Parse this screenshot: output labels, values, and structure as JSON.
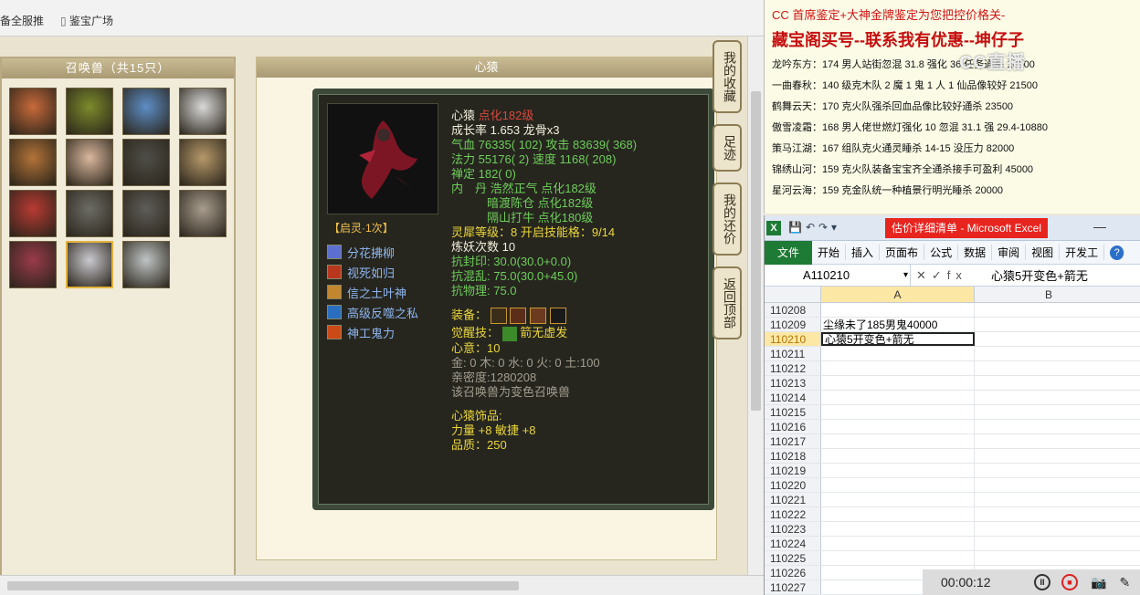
{
  "browser": {
    "bookmarks": [
      {
        "label": "备全服推"
      },
      {
        "label": "鉴宝广场"
      }
    ]
  },
  "summons_panel": {
    "title": "召唤兽（共15只）",
    "pets": [
      {
        "color": "#c86a3a"
      },
      {
        "color": "#7c8b2b"
      },
      {
        "color": "#5d8ec6"
      },
      {
        "color": "#d9d9d9"
      },
      {
        "color": "#b37338"
      },
      {
        "color": "#d9b79d"
      },
      {
        "color": "#4e4e48"
      },
      {
        "color": "#b6996a"
      },
      {
        "color": "#b83a33"
      },
      {
        "color": "#6c6c66"
      },
      {
        "color": "#5e5d59"
      },
      {
        "color": "#a89d8e"
      },
      {
        "color": "#9a3b4a"
      },
      {
        "color": "#c9c9cf",
        "selected": true
      },
      {
        "color": "#bfc4c4"
      }
    ]
  },
  "detail_panel": {
    "title": "心猿",
    "awaken": "启灵·1次",
    "skills": [
      {
        "label": "分花拂柳",
        "color": "#5c6fd0"
      },
      {
        "label": "视死如归",
        "color": "#b9371c"
      },
      {
        "label": "信之土叶神",
        "color": "#c2862e"
      },
      {
        "label": "高级反噬之私",
        "color": "#2a6fbf"
      },
      {
        "label": "神工鬼力",
        "color": "#cc4a17"
      }
    ],
    "stats": {
      "name": "心猿",
      "level": "点化182级",
      "growth": "成长率 1.653 龙骨x3",
      "hp": "气血 76335( 102) 攻击 83639( 368)",
      "mp": "法力 55176( 2) 速度 1168( 208)",
      "ding": "禅定 182( 0)",
      "neidan": [
        "内　丹 浩然正气 点化182级",
        "　　　暗渡陈仓 点化182级",
        "　　　隔山打牛 点化180级"
      ],
      "lingxi": "灵犀等级：8 开启技能格：9/14",
      "lianyao": "炼妖次数 10",
      "kangfeng": "抗封印: 30.0(30.0+0.0)",
      "kanghun": "抗混乱: 75.0(30.0+45.0)",
      "kangwuli": "抗物理: 75.0",
      "equip_label": "装备：",
      "awaken_skill_label": "觉醒技：",
      "awaken_skill": "箭无虚发",
      "xinyi": "心意：10",
      "elements": "金: 0 木: 0 水: 0 火: 0 土:100",
      "intimacy": "亲密度:1280208",
      "transform": "该召唤兽为变色召唤兽",
      "accessory_title": "心猿饰品:",
      "accessory_attr": "力量 +8 敏捷 +8",
      "quality": "品质：250"
    }
  },
  "side_tabs": [
    {
      "label": "我的收藏"
    },
    {
      "label": "足迹"
    },
    {
      "label": "我的还价"
    },
    {
      "label": "返回顶部"
    }
  ],
  "ad": {
    "title": "CC 首席鉴定+大神金牌鉴定为您把控价格关-",
    "headline": "藏宝阁买号--联系我有优惠--坤仔子",
    "lines": [
      "龙吟东方：174 男人站街忽混 31.8 强化 36 任务通杀 10000",
      "一曲春秋：140 级克木队 2 魔 1 鬼 1 人 1 仙品像较好 21500",
      "鹤舞云天：170 克火队强杀回血品像比较好通杀 23500",
      "傲雪凌霜：168 男人佬世燃灯强化 10 忽混 31.1 强 29.4-10880",
      "策马江湖：167 组队克火通灵睡杀 14-15 没压力 82000",
      "锦绣山河：159 克火队装备宝宝齐全通杀接手可盈利 45000",
      "星河云海：159 克金队统一种植景行明光睡杀 20000"
    ]
  },
  "excel": {
    "window_title": "估价详细清单 - Microsoft Excel",
    "tabs": [
      "文件",
      "开始",
      "插入",
      "页面布",
      "公式",
      "数据",
      "审阅",
      "视图",
      "开发工"
    ],
    "name_box": "A110210",
    "formula_content": "心猿5开变色+箭无",
    "columns": [
      "A",
      "B"
    ],
    "rows": [
      {
        "num": "110208",
        "a": ""
      },
      {
        "num": "110209",
        "a": "尘缘未了185男鬼40000"
      },
      {
        "num": "110210",
        "a": "心猿5开变色+箭无",
        "active": true
      },
      {
        "num": "110211",
        "a": ""
      },
      {
        "num": "110212",
        "a": ""
      },
      {
        "num": "110213",
        "a": ""
      },
      {
        "num": "110214",
        "a": ""
      },
      {
        "num": "110215",
        "a": ""
      },
      {
        "num": "110216",
        "a": ""
      },
      {
        "num": "110217",
        "a": ""
      },
      {
        "num": "110218",
        "a": ""
      },
      {
        "num": "110219",
        "a": ""
      },
      {
        "num": "110220",
        "a": ""
      },
      {
        "num": "110221",
        "a": ""
      },
      {
        "num": "110222",
        "a": ""
      },
      {
        "num": "110223",
        "a": ""
      },
      {
        "num": "110224",
        "a": ""
      },
      {
        "num": "110225",
        "a": ""
      },
      {
        "num": "110226",
        "a": ""
      },
      {
        "num": "110227",
        "a": ""
      }
    ]
  },
  "recorder": {
    "time": "00:00:12"
  },
  "watermark": "CC直播"
}
